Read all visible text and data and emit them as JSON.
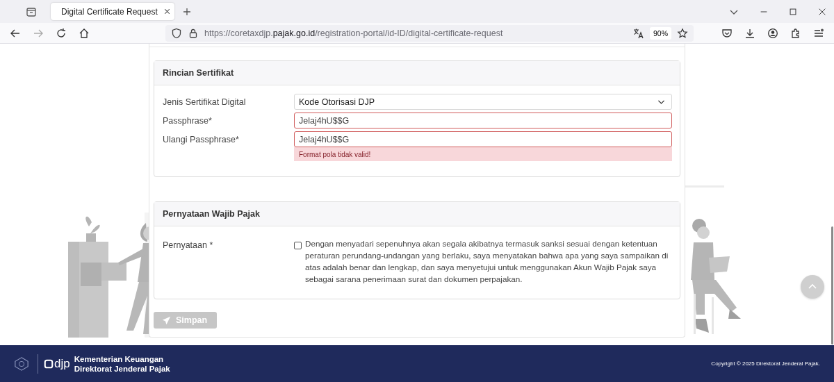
{
  "browser": {
    "tab": {
      "title": "Digital Certificate Request",
      "selected": true
    },
    "url": {
      "before": "https://coretaxdjp.",
      "domain": "pajak.go.id",
      "after": "/registration-portal/id-ID/digital-certificate-request"
    },
    "zoom": "90%"
  },
  "certificate_section": {
    "title": "Rincian Sertifikat",
    "fields": [
      {
        "kind": "select",
        "label": "Jenis Sertifikat Digital",
        "value": "Kode Otorisasi DJP",
        "invalid": false
      },
      {
        "kind": "input",
        "label": "Passphrase*",
        "value": "Jelaj4hU$$G",
        "invalid": true
      },
      {
        "kind": "input",
        "label": "Ulangi Passphrase*",
        "value": "Jelaj4hU$$G",
        "invalid": true
      }
    ],
    "error": "Format pola tidak valid!"
  },
  "statement_section": {
    "title": "Pernyataan Wajib Pajak",
    "label": "Pernyataan *",
    "checked": false,
    "text": "Dengan menyadari sepenuhnya akan segala akibatnya termasuk sanksi sesuai dengan ketentuan peraturan perundang-undangan yang berlaku, saya menyatakan bahwa apa yang saya sampaikan di atas adalah benar dan lengkap, dan saya menyetujui untuk menggunakan Akun Wajib Pajak saya sebagai sarana penerimaan surat dan dokumen perpajakan."
  },
  "save_button": {
    "label": "Simpan",
    "disabled": true
  },
  "footer": {
    "logo": "djp",
    "org_lines": [
      "Kementerian Keuangan",
      "Direktorat Jenderal Pajak"
    ],
    "copyright": "Copyright © 2025 Direktorat Jenderal Pajak."
  }
}
